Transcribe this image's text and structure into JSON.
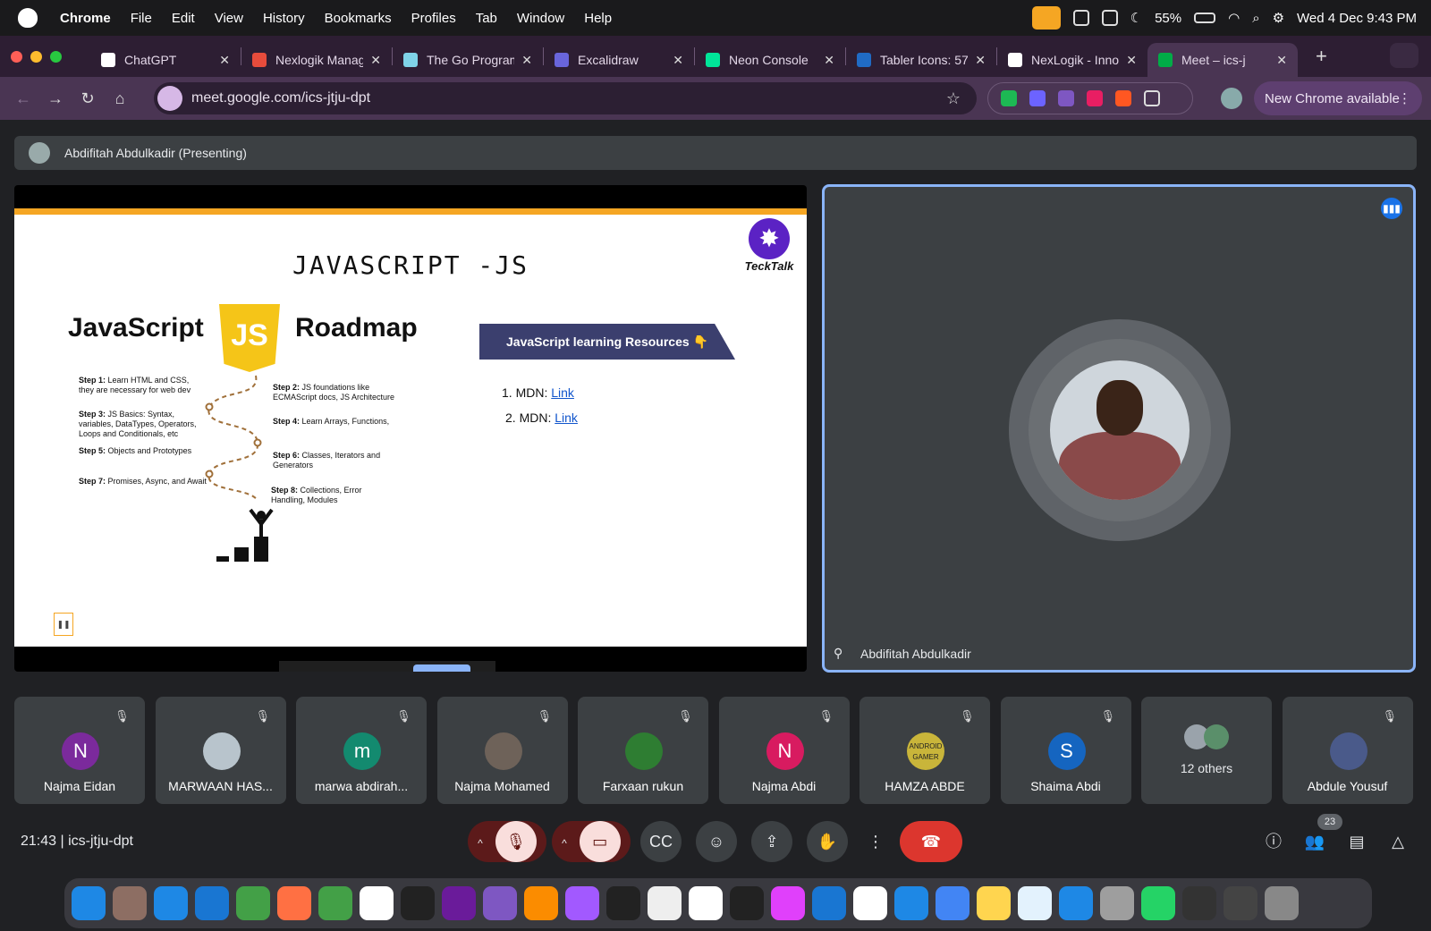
{
  "menubar": {
    "app": "Chrome",
    "items": [
      "File",
      "Edit",
      "View",
      "History",
      "Bookmarks",
      "Profiles",
      "Tab",
      "Window",
      "Help"
    ],
    "battery": "55%",
    "datetime": "Wed 4 Dec  9:43 PM"
  },
  "tabs": [
    {
      "title": "ChatGPT",
      "color": "#ffffff"
    },
    {
      "title": "Nexlogik Manag",
      "color": "#e74c3c"
    },
    {
      "title": "The Go Program",
      "color": "#7fd3e8"
    },
    {
      "title": "Excalidraw",
      "color": "#6965db"
    },
    {
      "title": "Neon Console",
      "color": "#00e599"
    },
    {
      "title": "Tabler Icons: 57",
      "color": "#206bc4"
    },
    {
      "title": "NexLogik - Inno",
      "color": "#ffffff"
    },
    {
      "title": "Meet – ics-j",
      "color": "#00ac47"
    }
  ],
  "toolbar": {
    "url": "meet.google.com/ics-jtju-dpt",
    "new_chrome": "New Chrome available"
  },
  "meet": {
    "presenting": "Abdifitah Abdulkadir (Presenting)",
    "spotlight_name": "Abdifitah Abdulkadir",
    "time": "21:43",
    "code": "ics-jtju-dpt",
    "participant_count": "23"
  },
  "slide": {
    "title": "JAVASCRIPT -JS",
    "badge": "TeckTalk",
    "heading_left": "JavaScript",
    "logo": "JS",
    "heading_right": "Roadmap",
    "steps": [
      {
        "label": "Step 1:",
        "text": "Learn HTML and CSS, they are necessary for web dev"
      },
      {
        "label": "Step 2:",
        "text": "JS foundations like ECMAScript docs, JS Architecture"
      },
      {
        "label": "Step 3:",
        "text": "JS Basics: Syntax, variables, DataTypes, Operators, Loops and Conditionals, etc"
      },
      {
        "label": "Step 4:",
        "text": "Learn Arrays, Functions,"
      },
      {
        "label": "Step 5:",
        "text": "Objects and Prototypes"
      },
      {
        "label": "Step 6:",
        "text": "Classes, Iterators and Generators"
      },
      {
        "label": "Step 7:",
        "text": "Promises, Async, and Await"
      },
      {
        "label": "Step 8:",
        "text": "Collections, Error Handling, Modules"
      }
    ],
    "resources_banner": "JavaScript learning Resources 👇",
    "resources": [
      {
        "num": "1.",
        "name": "MDN:",
        "link": "Link"
      },
      {
        "num": "2.",
        "name": "MDN:",
        "link": "Link"
      }
    ]
  },
  "participants": [
    {
      "name": "Najma Eidan",
      "initial": "N",
      "color": "#7b2a9c"
    },
    {
      "name": "MARWAAN HAS...",
      "initial": "",
      "color": "#b8c4cc"
    },
    {
      "name": "marwa abdirah...",
      "initial": "m",
      "color": "#138a6f"
    },
    {
      "name": "Najma Mohamed",
      "initial": "",
      "color": "#6e6259"
    },
    {
      "name": "Farxaan rukun",
      "initial": "",
      "color": "#2e7d32"
    },
    {
      "name": "Najma Abdi",
      "initial": "N",
      "color": "#d81b60"
    },
    {
      "name": "HAMZA ABDE",
      "initial": "ANDROID GAMER",
      "color": "#c9b53a"
    },
    {
      "name": "Shaima Abdi",
      "initial": "S",
      "color": "#1565c0"
    },
    {
      "name": "12 others",
      "initial": "",
      "color": "#5f6368"
    },
    {
      "name": "Abdule Yousuf",
      "initial": "",
      "color": "#4a5a8a"
    }
  ],
  "dock_colors": [
    "#1e88e5",
    "#8d6e63",
    "#1e88e5",
    "#1976d2",
    "#43a047",
    "#ff7043",
    "#43a047",
    "#ffffff",
    "#222",
    "#6a1b9a",
    "#7e57c2",
    "#fb8c00",
    "#a259ff",
    "#222",
    "#eee",
    "#fff",
    "#222",
    "#e040fb",
    "#1976d2",
    "#fff",
    "#1e88e5",
    "#4285f4",
    "#ffd54f",
    "#e3f2fd",
    "#1e88e5",
    "#9e9e9e",
    "#25d366",
    "#333",
    "#444",
    "#888"
  ]
}
